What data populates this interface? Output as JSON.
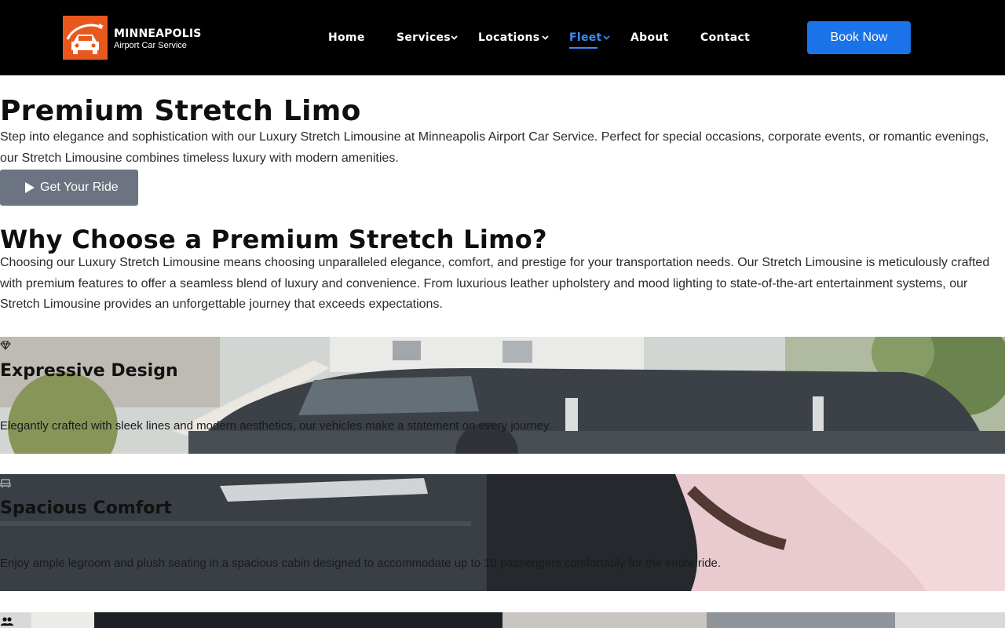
{
  "header": {
    "brand_name": "MINNEAPOLIS",
    "brand_subtitle": "Airport Car Service",
    "nav": [
      {
        "label": "Home",
        "has_dropdown": false,
        "active": false
      },
      {
        "label": "Services",
        "has_dropdown": true,
        "active": false
      },
      {
        "label": "Locations",
        "has_dropdown": true,
        "active": false
      },
      {
        "label": "Fleet",
        "has_dropdown": true,
        "active": true
      },
      {
        "label": "About",
        "has_dropdown": false,
        "active": false
      },
      {
        "label": "Contact",
        "has_dropdown": false,
        "active": false
      }
    ],
    "book_button": "Book Now"
  },
  "hero": {
    "title": "Premium Stretch Limo",
    "text": "Step into elegance and sophistication with our Luxury Stretch Limousine at Minneapolis Airport Car Service. Perfect for special occasions, corporate events, or romantic evenings, our Stretch Limousine combines timeless luxury with modern amenities.",
    "cta": "Get Your Ride"
  },
  "why": {
    "title": "Why Choose a Premium Stretch Limo?",
    "text": "Choosing our Luxury Stretch Limousine means choosing unparalleled elegance, comfort, and prestige for your transportation needs. Our Stretch Limousine is meticulously crafted with premium features to offer a seamless blend of luxury and convenience. From luxurious leather upholstery and mood lighting to state-of-the-art entertainment systems, our Stretch Limousine provides an unforgettable journey that exceeds expectations."
  },
  "features": [
    {
      "icon": "gem-icon",
      "title": "Expressive Design",
      "text": "Elegantly crafted with sleek lines and modern aesthetics, our vehicles make a statement on every journey."
    },
    {
      "icon": "car-seat-icon",
      "title": "Spacious Comfort",
      "text": "Enjoy ample legroom and plush seating in a spacious cabin designed to accommodate up to 10 passengers comfortably for the entire ride."
    },
    {
      "icon": "users-icon",
      "title": "",
      "text": ""
    }
  ],
  "colors": {
    "header_bg": "#000000",
    "logo_bg": "#e8581c",
    "accent": "#1a73e8",
    "active_nav": "#3a8bff",
    "cta_bg": "#6b7480"
  }
}
